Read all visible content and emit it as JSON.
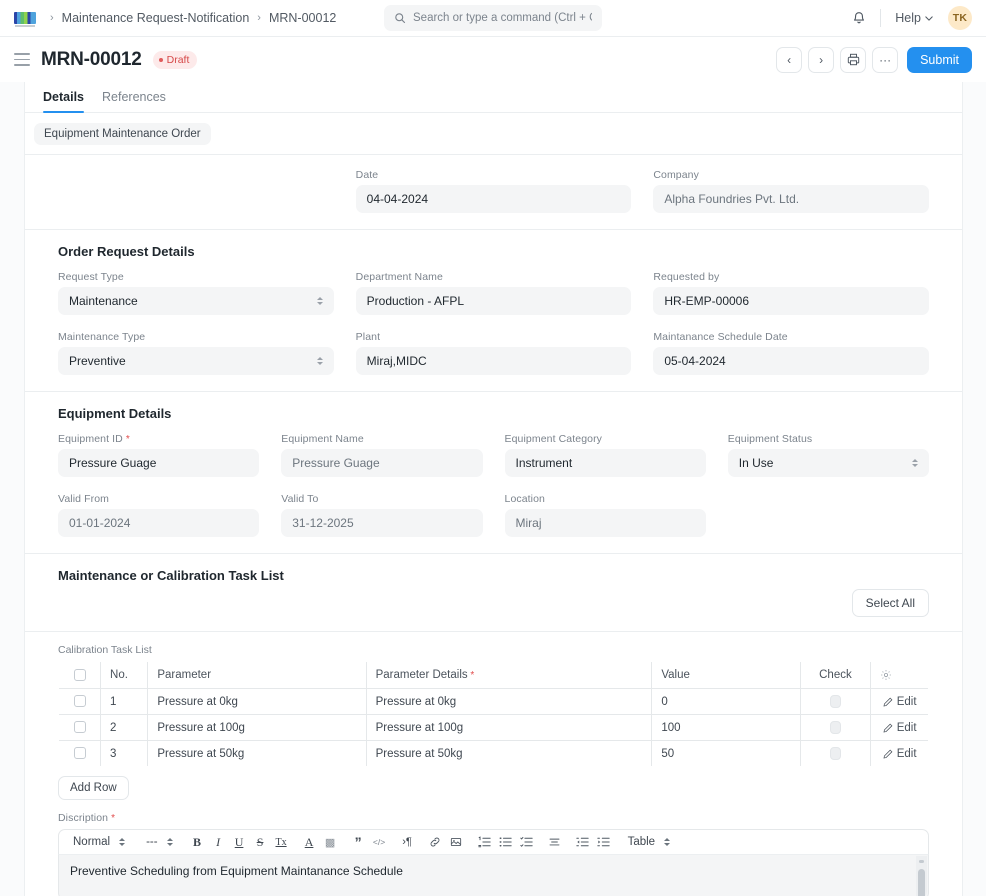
{
  "navbar": {
    "logo_icon": "frappe-logo-icon",
    "breadcrumbs": [
      {
        "label": "Maintenance Request-Notification"
      },
      {
        "label": "MRN-00012"
      }
    ],
    "search": {
      "placeholder": "Search or type a command (Ctrl + G)",
      "value": "",
      "icon": "search-icon"
    },
    "notification_icon": "bell-icon",
    "help_label": "Help",
    "help_caret": "chevron-down-icon",
    "avatar_initials": "TK"
  },
  "pagehead": {
    "menu_icon": "hamburger-icon",
    "title": "MRN-00012",
    "status": "Draft",
    "actions": {
      "prev": "‹",
      "next": "›",
      "print_icon": "printer-icon",
      "more": "···",
      "submit_label": "Submit"
    }
  },
  "tabs": [
    {
      "label": "Details",
      "active": true
    },
    {
      "label": "References",
      "active": false
    }
  ],
  "pill": {
    "label": "Equipment Maintenance Order"
  },
  "top_section": {
    "date": {
      "label": "Date",
      "value": "04-04-2024"
    },
    "company": {
      "label": "Company",
      "value": "Alpha Foundries Pvt. Ltd."
    }
  },
  "order_request": {
    "title": "Order Request Details",
    "request_type": {
      "label": "Request Type",
      "value": "Maintenance"
    },
    "department_name": {
      "label": "Department Name",
      "value": "Production - AFPL"
    },
    "requested_by": {
      "label": "Requested by",
      "value": "HR-EMP-00006"
    },
    "maintenance_type": {
      "label": "Maintenance Type",
      "value": "Preventive"
    },
    "plant": {
      "label": "Plant",
      "value": "Miraj,MIDC"
    },
    "schedule_date": {
      "label": "Maintanance Schedule Date",
      "value": "05-04-2024"
    }
  },
  "equipment": {
    "title": "Equipment Details",
    "equipment_id": {
      "label": "Equipment ID",
      "value": "Pressure Guage",
      "required": true
    },
    "equipment_name": {
      "label": "Equipment Name",
      "value": "Pressure Guage"
    },
    "equipment_category": {
      "label": "Equipment Category",
      "value": "Instrument"
    },
    "equipment_status": {
      "label": "Equipment Status",
      "value": "In Use"
    },
    "valid_from": {
      "label": "Valid From",
      "value": "01-01-2024"
    },
    "valid_to": {
      "label": "Valid To",
      "value": "31-12-2025"
    },
    "location": {
      "label": "Location",
      "value": "Miraj"
    }
  },
  "task_list": {
    "title": "Maintenance or Calibration Task List",
    "select_all_label": "Select All",
    "table_label": "Calibration Task List",
    "columns": [
      {
        "label": "",
        "key": "checkbox"
      },
      {
        "label": "No.",
        "key": "no"
      },
      {
        "label": "Parameter",
        "key": "parameter"
      },
      {
        "label": "Parameter Details",
        "key": "details",
        "required": true
      },
      {
        "label": "Value",
        "key": "value"
      },
      {
        "label": "Check",
        "key": "check"
      },
      {
        "label": "",
        "key": "settings",
        "icon": "gear-icon"
      }
    ],
    "rows": [
      {
        "no": "1",
        "parameter": "Pressure at 0kg",
        "details": "Pressure at 0kg",
        "value": "0",
        "edit_label": "Edit"
      },
      {
        "no": "2",
        "parameter": "Pressure at 100g",
        "details": "Pressure at 100g",
        "value": "100",
        "edit_label": "Edit"
      },
      {
        "no": "3",
        "parameter": "Pressure at 50kg",
        "details": "Pressure at 50kg",
        "value": "50",
        "edit_label": "Edit"
      }
    ],
    "add_row_label": "Add Row"
  },
  "description": {
    "label": "Discription",
    "required": true,
    "toolbar": {
      "style_select": "Normal",
      "font_select": "---",
      "buttons": [
        {
          "icon": "bold-icon",
          "glyph": "B"
        },
        {
          "icon": "italic-icon",
          "glyph": "I"
        },
        {
          "icon": "underline-icon",
          "glyph": "U"
        },
        {
          "icon": "strikethrough-icon",
          "glyph": "S"
        },
        {
          "icon": "clear-format-icon",
          "glyph": "Tx"
        },
        {
          "icon": "font-color-icon",
          "glyph": "A"
        },
        {
          "icon": "highlight-icon",
          "glyph": "▩"
        },
        {
          "icon": "blockquote-icon",
          "glyph": "”"
        },
        {
          "icon": "code-block-icon",
          "glyph": "</>"
        },
        {
          "icon": "text-direction-icon",
          "glyph": "¶"
        },
        {
          "icon": "link-icon",
          "glyph": "link"
        },
        {
          "icon": "image-icon",
          "glyph": "image"
        },
        {
          "icon": "ordered-list-icon",
          "glyph": "ol"
        },
        {
          "icon": "bullet-list-icon",
          "glyph": "ul"
        },
        {
          "icon": "check-list-icon",
          "glyph": "cl"
        },
        {
          "icon": "align-icon",
          "glyph": "align"
        },
        {
          "icon": "outdent-icon",
          "glyph": "outdent"
        },
        {
          "icon": "indent-icon",
          "glyph": "indent"
        }
      ],
      "table_label": "Table"
    },
    "content": "Preventive Scheduling from Equipment Maintanance Schedule"
  },
  "colors": {
    "accent": "#2490ef",
    "draft": "#d64949",
    "field_bg": "#f4f5f6",
    "border": "#e5e8ea",
    "text": "#1f272e",
    "muted": "#7c848d"
  }
}
